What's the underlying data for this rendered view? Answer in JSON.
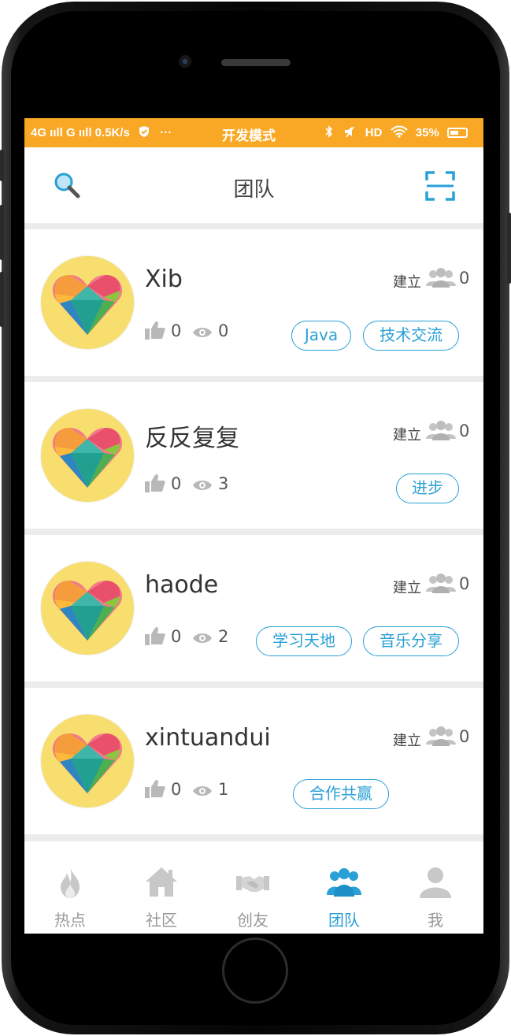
{
  "status_bar": {
    "left_text": "4G ııll G ııll 0.5K/s",
    "more": "···",
    "mode": "开发模式",
    "right_text": "HD",
    "battery": "35%"
  },
  "header": {
    "title": "团队",
    "search_icon": "search-icon",
    "scan_icon": "scan-icon"
  },
  "found_label": "建立",
  "teams": [
    {
      "name": "Xib",
      "members": "0",
      "likes": "0",
      "views": "0",
      "tags": [
        "Java",
        "技术交流"
      ]
    },
    {
      "name": "反反复复",
      "members": "0",
      "likes": "0",
      "views": "3",
      "tags": [
        "进步"
      ]
    },
    {
      "name": "haode",
      "members": "0",
      "likes": "0",
      "views": "2",
      "tags": [
        "学习天地",
        "音乐分享"
      ]
    },
    {
      "name": "xintuandui",
      "members": "0",
      "likes": "0",
      "views": "1",
      "tags": [
        "合作共赢"
      ]
    }
  ],
  "tabs": [
    {
      "label": "热点",
      "icon": "flame-icon"
    },
    {
      "label": "社区",
      "icon": "house-icon"
    },
    {
      "label": "创友",
      "icon": "handshake-icon"
    },
    {
      "label": "团队",
      "icon": "team-icon",
      "active": true
    },
    {
      "label": "我",
      "icon": "person-icon"
    }
  ],
  "colors": {
    "status_bar": "#f9a825",
    "accent": "#2aa0d6",
    "inactive": "#999999"
  }
}
